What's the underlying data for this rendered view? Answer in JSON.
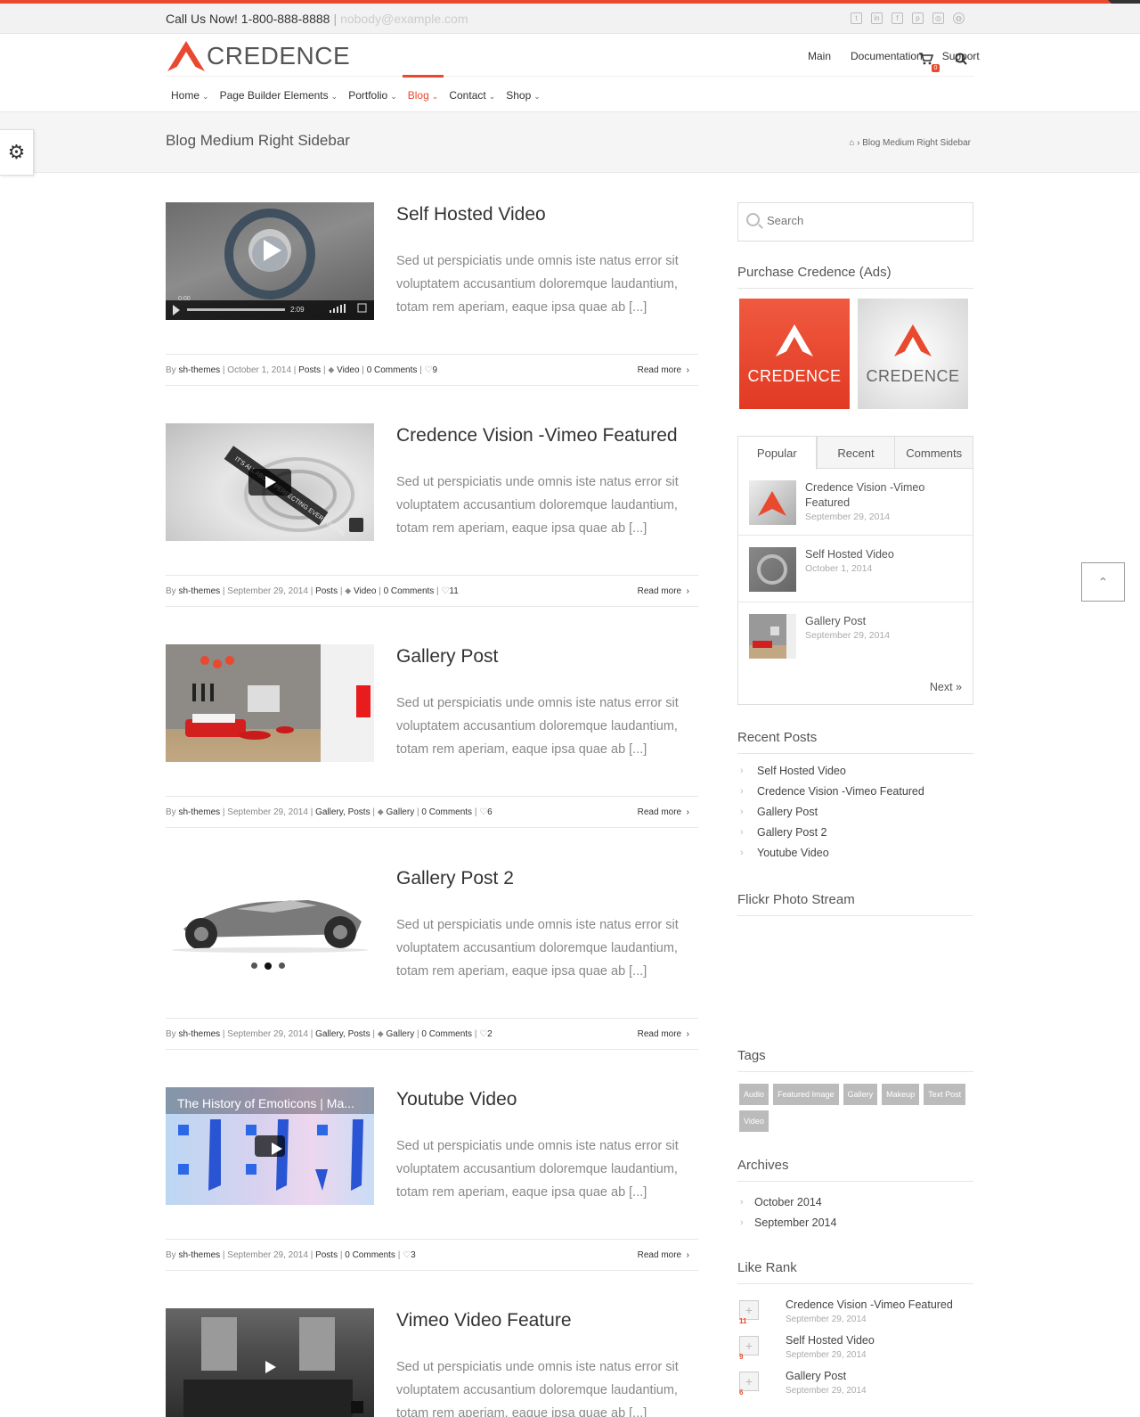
{
  "topbar": {
    "phone": "Call Us Now! 1-800-888-8888",
    "sep": "|",
    "email": "nobody@example.com"
  },
  "social_icons": [
    "twitter-icon",
    "linkedin-icon",
    "facebook-icon",
    "pinterest-icon",
    "instagram-icon",
    "dribbble-icon"
  ],
  "logo": {
    "text": "CREDENCE"
  },
  "top_menu": [
    "Main",
    "Documentation",
    "Support"
  ],
  "nav": [
    {
      "label": "Home",
      "active": false
    },
    {
      "label": "Page Builder Elements",
      "active": false
    },
    {
      "label": "Portfolio",
      "active": false
    },
    {
      "label": "Blog",
      "active": true
    },
    {
      "label": "Contact",
      "active": false
    },
    {
      "label": "Shop",
      "active": false
    }
  ],
  "cart_count": "0",
  "page": {
    "title": "Blog Medium Right Sidebar",
    "breadcrumb": "Blog Medium Right Sidebar",
    "breadcrumb_sep": "›"
  },
  "excerpt": "Sed ut perspiciatis unde omnis iste natus error sit voluptatem accusantium doloremque laudantium, totam rem aperiam, eaque ipsa quae ab [...]",
  "read_more": "Read more",
  "posts": [
    {
      "title": "Self Hosted Video",
      "author": "sh-themes",
      "date": "October 1, 2014",
      "cats": "Posts",
      "tag": "Video",
      "comments": "0 Comments",
      "likes": "9",
      "thumb_time": "0:00",
      "thumb_dur": "2:09"
    },
    {
      "title": "Credence Vision -Vimeo Featured",
      "author": "sh-themes",
      "date": "September 29, 2014",
      "cats": "Posts",
      "tag": "Video",
      "comments": "0 Comments",
      "likes": "11",
      "thumb_text": "IT'S ALL ABOUT PERFECTING EVERY DETAIL"
    },
    {
      "title": "Gallery Post",
      "author": "sh-themes",
      "date": "September 29, 2014",
      "cats": "Gallery, Posts",
      "tag": "Gallery",
      "comments": "0 Comments",
      "likes": "6"
    },
    {
      "title": "Gallery Post 2",
      "author": "sh-themes",
      "date": "September 29, 2014",
      "cats": "Gallery, Posts",
      "tag": "Gallery",
      "comments": "0 Comments",
      "likes": "2"
    },
    {
      "title": "Youtube Video",
      "author": "sh-themes",
      "date": "September 29, 2014",
      "cats": "Posts",
      "tag": "",
      "comments": "0 Comments",
      "likes": "3",
      "thumb_caption": "The History of Emoticons | Ma..."
    },
    {
      "title": "Vimeo Video Feature",
      "author": "",
      "date": "",
      "cats": "",
      "tag": "",
      "comments": "",
      "likes": ""
    }
  ],
  "meta_by": "By",
  "sidebar": {
    "search_placeholder": "Search",
    "ads_title": "Purchase Credence (Ads)",
    "ad_label": "CREDENCE",
    "tabs": [
      "Popular",
      "Recent",
      "Comments"
    ],
    "popular": [
      {
        "title": "Credence Vision -Vimeo Featured",
        "date": "September 29, 2014"
      },
      {
        "title": "Self Hosted Video",
        "date": "October 1, 2014"
      },
      {
        "title": "Gallery Post",
        "date": "September 29, 2014"
      }
    ],
    "next": "Next »",
    "recent_title": "Recent Posts",
    "recent": [
      "Self Hosted Video",
      "Credence Vision -Vimeo Featured",
      "Gallery Post",
      "Gallery Post 2",
      "Youtube Video"
    ],
    "flickr_title": "Flickr Photo Stream",
    "tags_title": "Tags",
    "tags": [
      "Audio",
      "Featured Image",
      "Gallery",
      "Makeup",
      "Text Post",
      "Video"
    ],
    "archives_title": "Archives",
    "archives": [
      "October 2014",
      "September 2014"
    ],
    "like_title": "Like Rank",
    "like": [
      {
        "title": "Credence Vision -Vimeo Featured",
        "date": "September 29, 2014",
        "count": "11"
      },
      {
        "title": "Self Hosted Video",
        "date": "September 29, 2014",
        "count": "9"
      },
      {
        "title": "Gallery Post",
        "date": "September 29, 2014",
        "count": "6"
      }
    ]
  },
  "colors": {
    "accent": "#e8492f",
    "text": "#444444",
    "muted": "#888888"
  }
}
